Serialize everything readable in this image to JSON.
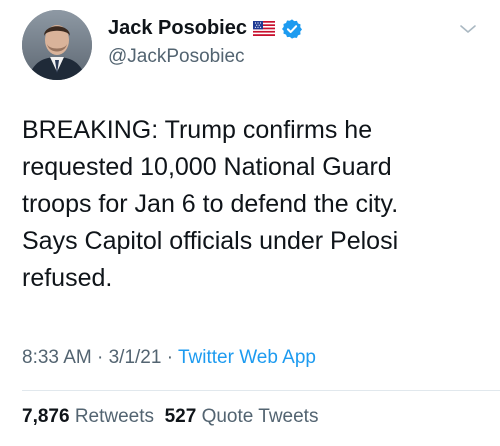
{
  "author": {
    "display_name": "Jack Posobiec",
    "handle": "@JackPosobiec",
    "flag_icon": "us-flag-icon",
    "verified_icon": "verified-badge-icon"
  },
  "tweet": {
    "text": "BREAKING: Trump confirms he\nrequested 10,000 National Guard\ntroops for Jan 6 to defend the city.\nSays Capitol officials under Pelosi\nrefused."
  },
  "meta": {
    "time": "8:33 AM",
    "separator": " · ",
    "date": "3/1/21",
    "source": "Twitter Web App"
  },
  "stats": {
    "retweets_count": "7,876",
    "retweets_label": "Retweets",
    "quotes_count": "527",
    "quotes_label": "Quote Tweets"
  },
  "colors": {
    "accent": "#1d9bf0",
    "text": "#0f1419",
    "secondary": "#536471"
  }
}
